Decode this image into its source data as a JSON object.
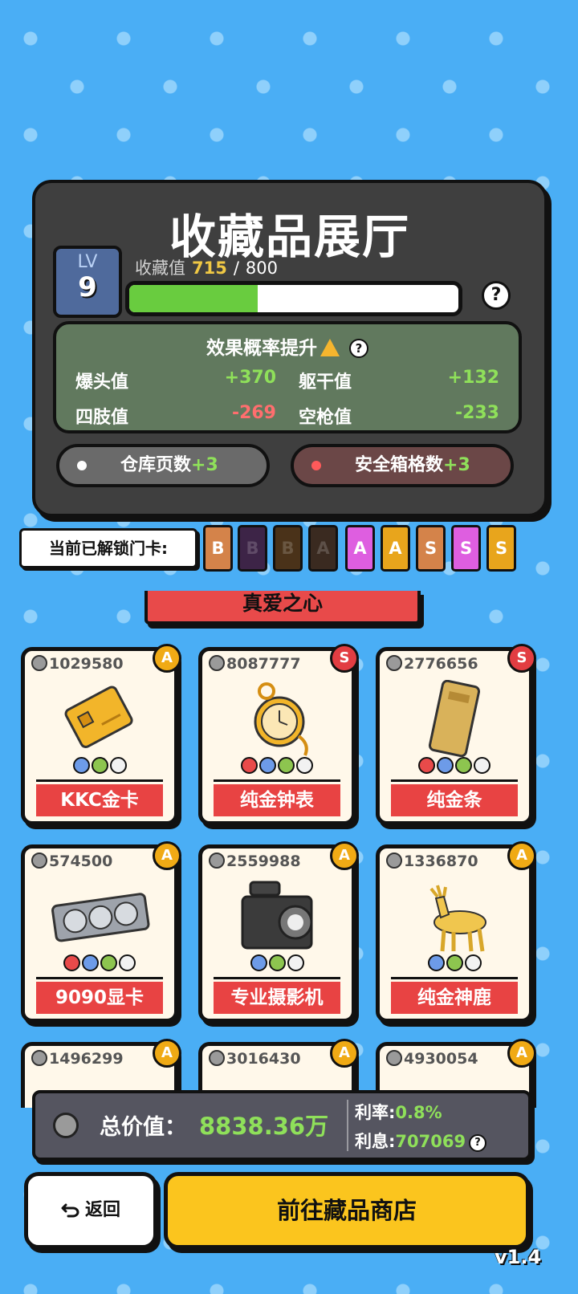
{
  "hall": {
    "title": "收藏品展厅",
    "level_label": "LV",
    "level": "9",
    "collection_label": "收藏值",
    "collection_current": "715",
    "collection_sep": "/",
    "collection_max": "800",
    "collection_progress": 0.39,
    "help": "?"
  },
  "effects": {
    "title": "效果概率提升",
    "help": "?",
    "stats": [
      {
        "label": "爆头值",
        "value": "+370",
        "tone": "pos"
      },
      {
        "label": "躯干值",
        "value": "+132",
        "tone": "pos"
      },
      {
        "label": "四肢值",
        "value": "-269",
        "tone": "neg"
      },
      {
        "label": "空枪值",
        "value": "-233",
        "tone": "pos"
      }
    ]
  },
  "bonuses": [
    {
      "label": "仓库页数",
      "plus": "+3"
    },
    {
      "label": "安全箱格数",
      "plus": "+3"
    }
  ],
  "gates": {
    "label": "当前已解锁门卡:",
    "cards": [
      {
        "letter": "B",
        "color": "#d4834a",
        "dim": false
      },
      {
        "letter": "B",
        "color": "#3d2447",
        "dim": true
      },
      {
        "letter": "B",
        "color": "#4a3219",
        "dim": true
      },
      {
        "letter": "A",
        "color": "#3a2a20",
        "dim": true
      },
      {
        "letter": "A",
        "color": "#de5ee0",
        "dim": false
      },
      {
        "letter": "A",
        "color": "#e8a51c",
        "dim": false
      },
      {
        "letter": "S",
        "color": "#d4834a",
        "dim": false
      },
      {
        "letter": "S",
        "color": "#de5ee0",
        "dim": false
      },
      {
        "letter": "S",
        "color": "#e8a51c",
        "dim": false
      }
    ]
  },
  "banner": "真爱之心",
  "items": [
    {
      "value": "1029580",
      "rank": "A",
      "name": "KKC金卡",
      "art": "gold-card-icon",
      "shapes": [
        "blue",
        "green",
        "white"
      ]
    },
    {
      "value": "8087777",
      "rank": "S",
      "name": "纯金钟表",
      "art": "gold-pocket-watch-icon",
      "shapes": [
        "red",
        "blue",
        "green",
        "white"
      ]
    },
    {
      "value": "2776656",
      "rank": "S",
      "name": "纯金条",
      "art": "gold-bar-icon",
      "shapes": [
        "red",
        "blue",
        "green",
        "white"
      ]
    },
    {
      "value": "574500",
      "rank": "A",
      "name": "9090显卡",
      "art": "graphics-card-icon",
      "shapes": [
        "red",
        "blue",
        "green",
        "white"
      ]
    },
    {
      "value": "2559988",
      "rank": "A",
      "name": "专业摄影机",
      "art": "video-camera-icon",
      "shapes": [
        "blue",
        "green",
        "white"
      ]
    },
    {
      "value": "1336870",
      "rank": "A",
      "name": "纯金神鹿",
      "art": "gold-deer-icon",
      "shapes": [
        "blue",
        "green",
        "white"
      ]
    },
    {
      "value": "1496299",
      "rank": "A",
      "name": "",
      "art": "",
      "shapes": []
    },
    {
      "value": "3016430",
      "rank": "A",
      "name": "",
      "art": "",
      "shapes": []
    },
    {
      "value": "4930054",
      "rank": "A",
      "name": "",
      "art": "",
      "shapes": []
    }
  ],
  "footer": {
    "total_label": "总价值：",
    "total_value": "8838.36万",
    "rate_label": "利率:",
    "rate_value": "0.8%",
    "interest_label": "利息:",
    "interest_value": "707069",
    "help": "?"
  },
  "buttons": {
    "back_icon": "undo-arrow-icon",
    "back": "返回",
    "shop": "前往藏品商店"
  },
  "version": "v1.4",
  "colors": {
    "background": "#4aaef5",
    "panel": "#3f3f3f",
    "positive": "#8fe05a",
    "negative": "#ff6e6e",
    "rank_a": "#f0aa15",
    "rank_s": "#e23d42",
    "shop_button": "#fbc51e"
  }
}
